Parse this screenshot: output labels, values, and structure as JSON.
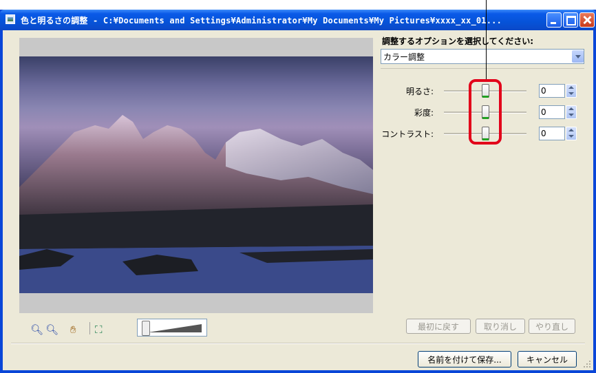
{
  "window": {
    "title": "色と明るさの調整 - C:¥Documents and Settings¥Administrator¥My Documents¥My Pictures¥xxxx_xx_01...",
    "icon": "app-icon"
  },
  "panel": {
    "options_label": "調整するオプションを選択してください:",
    "selected_option": "カラー調整"
  },
  "adjustments": [
    {
      "label": "明るさ:",
      "value": "0",
      "level": 0.5
    },
    {
      "label": "彩度:",
      "value": "0",
      "level": 0.5
    },
    {
      "label": "コントラスト:",
      "value": "0",
      "level": 0.5
    }
  ],
  "buttons": {
    "reset": "最初に戻す",
    "undo": "取り消し",
    "redo": "やり直し",
    "save_as": "名前を付けて保存...",
    "cancel": "キャンセル"
  },
  "tools": [
    "zoom-in-icon",
    "zoom-out-icon",
    "hand-icon",
    "fit-to-window-icon"
  ],
  "zoom_level": 0,
  "annotation_color": "#e2001a"
}
